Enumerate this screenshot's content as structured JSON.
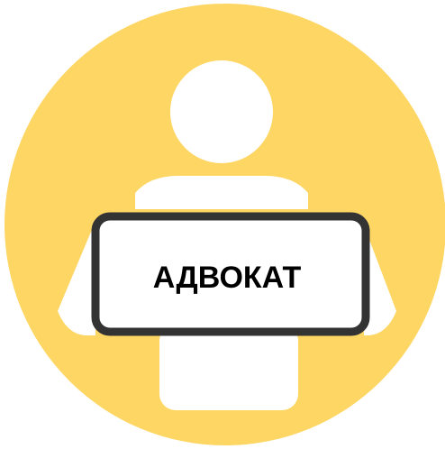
{
  "icon": {
    "name": "lawyer-person-with-sign-icon",
    "background_color": "#FDD664",
    "figure_color": "#FFFFFF",
    "sign_border_color": "#333333",
    "sign_fill_color": "#FFFFFF"
  },
  "sign": {
    "label": "АДВОКАТ"
  }
}
